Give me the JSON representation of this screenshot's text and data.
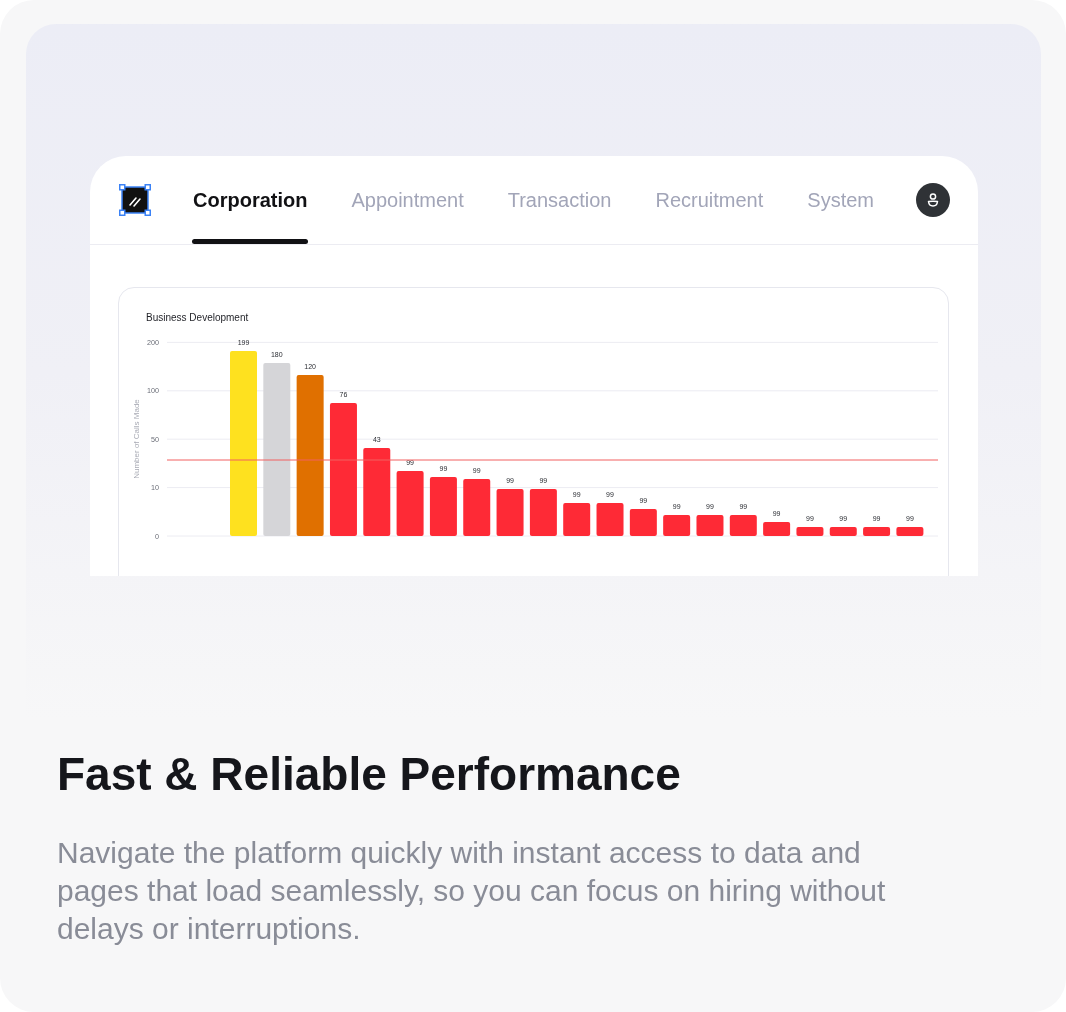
{
  "app_preview": {
    "tabs": [
      {
        "label": "Corporation",
        "selected": true
      },
      {
        "label": "Appointment",
        "selected": false
      },
      {
        "label": "Transaction",
        "selected": false
      },
      {
        "label": "Recruitment",
        "selected": false
      },
      {
        "label": "System",
        "selected": false
      }
    ],
    "chart_panel": {
      "title": "Business Development",
      "y_axis_title": "Number of Calls Made",
      "y_tick_labels": [
        "200",
        "100",
        "50",
        "10",
        "0"
      ],
      "bars": [
        {
          "value_label": "199",
          "color": "#fee11f"
        },
        {
          "value_label": "180",
          "color": "#d5d5d8"
        },
        {
          "value_label": "120",
          "color": "#e07000"
        },
        {
          "value_label": "76",
          "color": "#fe2a36"
        },
        {
          "value_label": "43",
          "color": "#fe2a36"
        },
        {
          "value_label": "99",
          "color": "#fe2a36"
        },
        {
          "value_label": "99",
          "color": "#fe2a36"
        },
        {
          "value_label": "99",
          "color": "#fe2a36"
        },
        {
          "value_label": "99",
          "color": "#fe2a36"
        },
        {
          "value_label": "99",
          "color": "#fe2a36"
        },
        {
          "value_label": "99",
          "color": "#fe2a36"
        },
        {
          "value_label": "99",
          "color": "#fe2a36"
        },
        {
          "value_label": "99",
          "color": "#fe2a36"
        },
        {
          "value_label": "99",
          "color": "#fe2a36"
        },
        {
          "value_label": "99",
          "color": "#fe2a36"
        },
        {
          "value_label": "99",
          "color": "#fe2a36"
        },
        {
          "value_label": "99",
          "color": "#fe2a36"
        },
        {
          "value_label": "99",
          "color": "#fe2a36"
        },
        {
          "value_label": "99",
          "color": "#fe2a36"
        },
        {
          "value_label": "99",
          "color": "#fe2a36"
        },
        {
          "value_label": "99",
          "color": "#fe2a36"
        }
      ]
    }
  },
  "heading": "Fast & Reliable Performance",
  "description": "Navigate the platform quickly with instant access to data and pages that load seamlessly, so you can focus on hiring without delays or interruptions."
}
